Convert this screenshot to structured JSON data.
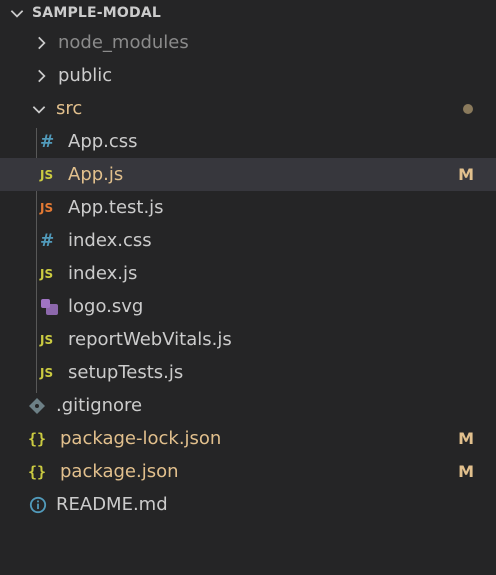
{
  "explorer": {
    "title": "SAMPLE-MODAL",
    "items": [
      {
        "label": "node_modules",
        "kind": "folder",
        "expanded": false,
        "color": "#8b8b8b"
      },
      {
        "label": "public",
        "kind": "folder",
        "expanded": false,
        "color": "#cccccc"
      },
      {
        "label": "src",
        "kind": "folder",
        "expanded": true,
        "color": "#e2c08d",
        "decoration": "dot"
      },
      {
        "label": "App.css",
        "kind": "css",
        "color": "#cccccc"
      },
      {
        "label": "App.js",
        "kind": "js",
        "color": "#e2c08d",
        "status": "M",
        "selected": true
      },
      {
        "label": "App.test.js",
        "kind": "test-js",
        "color": "#cccccc"
      },
      {
        "label": "index.css",
        "kind": "css",
        "color": "#cccccc"
      },
      {
        "label": "index.js",
        "kind": "js",
        "color": "#cccccc"
      },
      {
        "label": "logo.svg",
        "kind": "svg",
        "color": "#cccccc"
      },
      {
        "label": "reportWebVitals.js",
        "kind": "js",
        "color": "#cccccc"
      },
      {
        "label": "setupTests.js",
        "kind": "js",
        "color": "#cccccc"
      },
      {
        "label": ".gitignore",
        "kind": "git",
        "color": "#cccccc"
      },
      {
        "label": "package-lock.json",
        "kind": "json",
        "color": "#e2c08d",
        "status": "M"
      },
      {
        "label": "package.json",
        "kind": "json",
        "color": "#e2c08d",
        "status": "M"
      },
      {
        "label": "README.md",
        "kind": "info",
        "color": "#cccccc"
      }
    ],
    "icon_colors": {
      "js": "#cbcb41",
      "test_js": "#e37933",
      "css": "#519aba",
      "svg": "#a074c4",
      "git": "#6d8086",
      "info": "#519aba",
      "status_m": "#e2c08d"
    }
  }
}
